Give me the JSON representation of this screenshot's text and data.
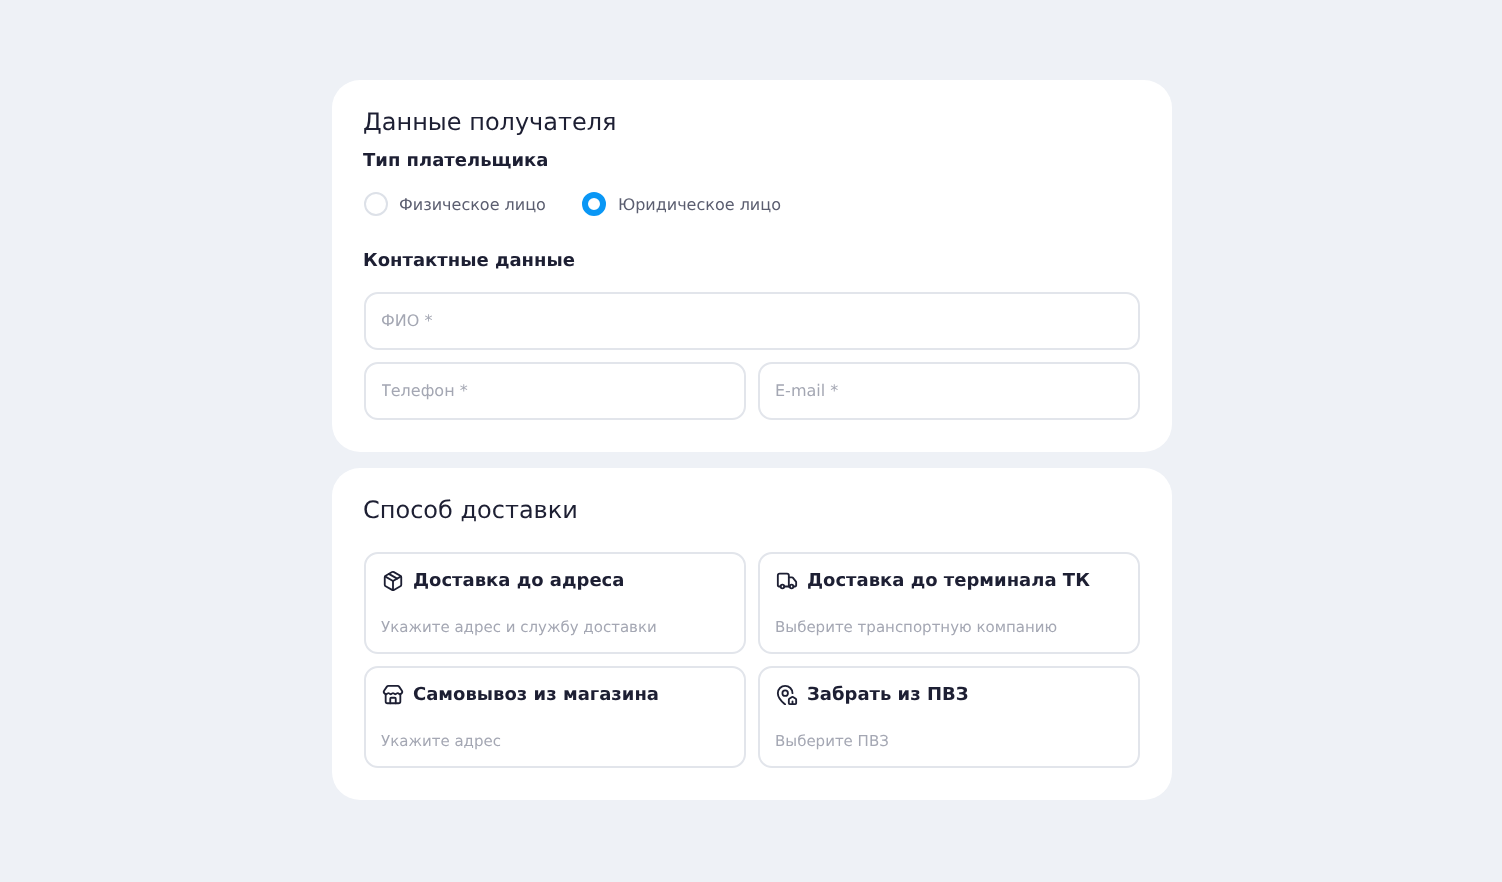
{
  "recipient": {
    "title": "Данные получателя",
    "payer_type": {
      "label": "Тип плательщика",
      "options": [
        {
          "label": "Физическое лицо",
          "selected": false
        },
        {
          "label": "Юридическое лицо",
          "selected": true
        }
      ]
    },
    "contacts": {
      "label": "Контактные данные",
      "fields": [
        {
          "placeholder": "ФИО *"
        },
        {
          "placeholder": "Телефон *"
        },
        {
          "placeholder": "E-mail *"
        }
      ]
    }
  },
  "delivery": {
    "title": "Способ доставки",
    "options": [
      {
        "kind": "box",
        "title": "Доставка до адреса",
        "hint": "Укажите адрес и службу доставки"
      },
      {
        "kind": "truck",
        "title": "Доставка до терминала ТК",
        "hint": "Выберите транспортную компанию"
      },
      {
        "kind": "store",
        "title": "Самовывоз из магазина",
        "hint": "Укажите адрес"
      },
      {
        "kind": "pin",
        "title": "Забрать из ПВЗ",
        "hint": "Выберите ПВЗ"
      }
    ]
  }
}
